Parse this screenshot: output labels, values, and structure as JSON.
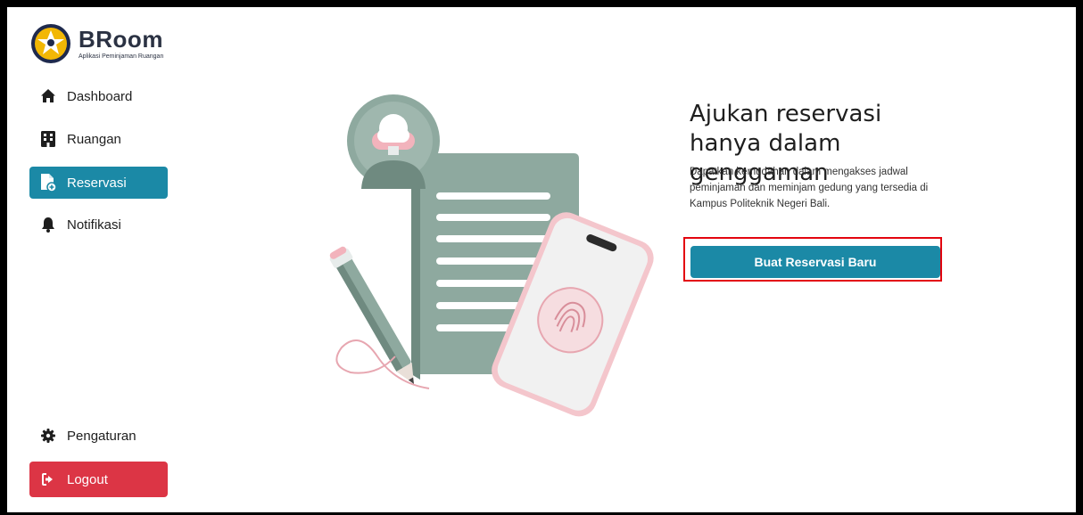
{
  "brand": {
    "title": "BRoom",
    "subtitle": "Aplikasi Peminjaman Ruangan"
  },
  "sidebar": {
    "items": [
      {
        "label": "Dashboard",
        "icon": "home-icon"
      },
      {
        "label": "Ruangan",
        "icon": "building-icon"
      },
      {
        "label": "Reservasi",
        "icon": "file-add-icon",
        "active": true
      },
      {
        "label": "Notifikasi",
        "icon": "bell-icon"
      }
    ],
    "settings_label": "Pengaturan",
    "logout_label": "Logout"
  },
  "main": {
    "headline": "Ajukan reservasi hanya dalam genggaman",
    "description": "Dapatkan kemudahan dalam mengakses jadwal peminjaman dan meminjam gedung yang tersedia di Kampus Politeknik Negeri Bali.",
    "cta_label": "Buat Reservasi Baru"
  },
  "colors": {
    "accent": "#1b89a6",
    "danger": "#dc3545",
    "highlight": "#e3050f"
  }
}
